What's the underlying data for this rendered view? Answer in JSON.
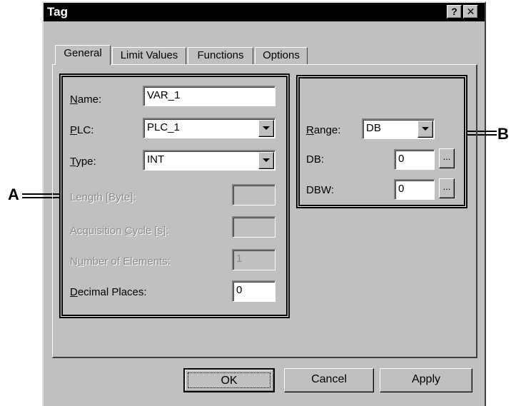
{
  "window": {
    "title": "Tag",
    "help_label": "?",
    "close_label": "✕"
  },
  "tabs": [
    {
      "label": "General",
      "active": true
    },
    {
      "label": "Limit Values",
      "active": false
    },
    {
      "label": "Functions",
      "active": false
    },
    {
      "label": "Options",
      "active": false
    }
  ],
  "general": {
    "name_label_u": "N",
    "name_label_rest": "ame:",
    "name_value": "VAR_1",
    "plc_label_u": "P",
    "plc_label_rest": "LC:",
    "plc_value": "PLC_1",
    "type_label_u": "T",
    "type_label_rest": "ype:",
    "type_value": "INT",
    "length_label": "Length [Byte]:",
    "length_value": "",
    "cycle_label_a": "Acquisition ",
    "cycle_label_u": "C",
    "cycle_label_b": "ycle [s]:",
    "cycle_value": "",
    "elements_label_a": "N",
    "elements_label_u": "u",
    "elements_label_b": "mber of Elements:",
    "elements_value": "1",
    "decimal_label_u": "D",
    "decimal_label_rest": "ecimal Places:",
    "decimal_value": "0"
  },
  "address": {
    "range_label_u": "R",
    "range_label_rest": "ange:",
    "range_value": "DB",
    "db_label": "DB:",
    "db_value": "0",
    "dbw_label": "DBW:",
    "dbw_value": "0",
    "browse_label": "..."
  },
  "buttons": {
    "ok": "OK",
    "cancel": "Cancel",
    "apply": "Apply"
  },
  "callouts": {
    "a": "A",
    "b": "B"
  }
}
